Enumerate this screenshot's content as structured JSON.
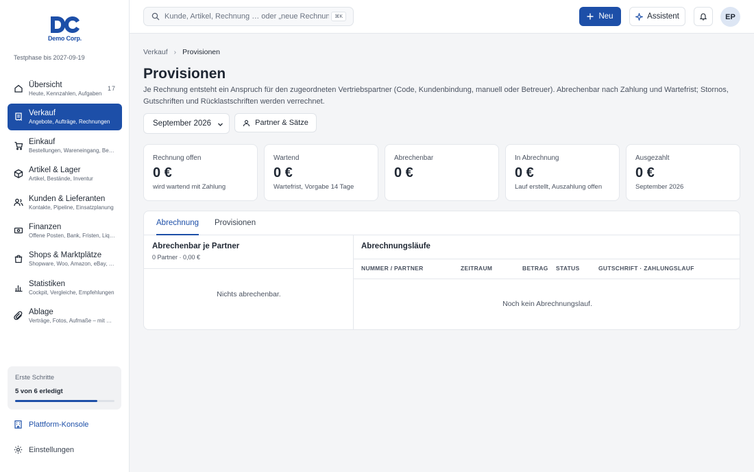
{
  "brand": {
    "logo_text": "Demo Corp.",
    "accent": "#1d4fa8"
  },
  "trial_text": "Testphase bis 2027-09-19",
  "nav": [
    {
      "label": "Übersicht",
      "sub": "Heute, Kennzahlen, Aufgaben",
      "count": "17",
      "icon": "home-icon"
    },
    {
      "label": "Verkauf",
      "sub": "Angebote, Aufträge, Rechnungen",
      "icon": "receipt-icon",
      "active": true
    },
    {
      "label": "Einkauf",
      "sub": "Bestellungen, Wareneingang, Bestand",
      "icon": "cart-icon"
    },
    {
      "label": "Artikel & Lager",
      "sub": "Artikel, Bestände, Inventur",
      "icon": "box-icon"
    },
    {
      "label": "Kunden & Lieferanten",
      "sub": "Kontakte, Pipeline, Einsatzplanung",
      "icon": "users-icon"
    },
    {
      "label": "Finanzen",
      "sub": "Offene Posten, Bank, Fristen, Liquidität",
      "icon": "money-icon"
    },
    {
      "label": "Shops & Marktplätze",
      "sub": "Shopware, Woo, Amazon, eBay, …",
      "icon": "shop-bag-icon"
    },
    {
      "label": "Statistiken",
      "sub": "Cockpit, Vergleiche, Empfehlungen",
      "icon": "bar-chart-icon"
    },
    {
      "label": "Ablage",
      "sub": "Verträge, Fotos, Aufmaße – mit …",
      "icon": "paperclip-icon"
    }
  ],
  "onboarding": {
    "title": "Erste Schritte",
    "progress_text": "5 von 6 erledigt",
    "progress": 0.83
  },
  "console_label": "Plattform-Konsole",
  "settings_label": "Einstellungen",
  "search": {
    "placeholder": "Kunde, Artikel, Rechnung … oder „neue Rechnung“",
    "shortcut": "⌘K"
  },
  "topbar": {
    "new_label": "Neu",
    "assistant_label": "Assistent",
    "avatar_initials": "EP"
  },
  "breadcrumb": {
    "parent": "Verkauf",
    "current": "Provisionen"
  },
  "page": {
    "title": "Provisionen",
    "description": "Je Rechnung entsteht ein Anspruch für den zugeordneten Vertriebspartner (Code, Kundenbindung, manuell oder Betreuer). Abrechenbar nach Zahlung und Wartefrist; Stornos, Gutschriften und Rücklastschriften werden verrechnet."
  },
  "period_select": "September 2026",
  "partner_button": "Partner & Sätze",
  "kpis": [
    {
      "label": "Rechnung offen",
      "value": "0 €",
      "sub": "wird wartend mit Zahlung"
    },
    {
      "label": "Wartend",
      "value": "0 €",
      "sub": "Wartefrist, Vorgabe 14 Tage"
    },
    {
      "label": "Abrechenbar",
      "value": "0 €",
      "sub": ""
    },
    {
      "label": "In Abrechnung",
      "value": "0 €",
      "sub": "Lauf erstellt, Auszahlung offen"
    },
    {
      "label": "Ausgezahlt",
      "value": "0 €",
      "sub": "September 2026"
    }
  ],
  "tabs": [
    {
      "label": "Abrechnung",
      "active": true
    },
    {
      "label": "Provisionen",
      "active": false
    }
  ],
  "left_panel": {
    "title": "Abrechenbar je Partner",
    "summary": "0 Partner · 0,00 €",
    "empty": "Nichts abrechenbar."
  },
  "right_panel": {
    "title": "Abrechnungsläufe",
    "columns": [
      "NUMMER / PARTNER",
      "ZEITRAUM",
      "BETRAG",
      "STATUS",
      "GUTSCHRIFT · ZAHLUNGSLAUF"
    ],
    "empty": "Noch kein Abrechnungslauf."
  }
}
